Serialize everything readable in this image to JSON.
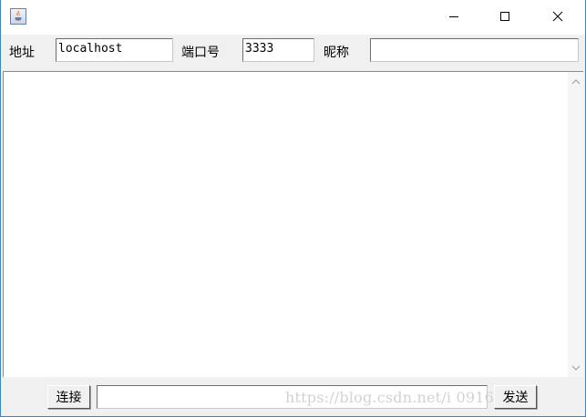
{
  "window": {
    "icon": "java-app-icon",
    "controls": {
      "minimize": "minimize-icon",
      "maximize": "maximize-icon",
      "close": "close-icon"
    }
  },
  "connection": {
    "address_label": "地址",
    "address_value": "localhost",
    "port_label": "端口号",
    "port_value": "3333",
    "nickname_label": "昵称",
    "nickname_value": ""
  },
  "chat": {
    "messages": ""
  },
  "footer": {
    "connect_label": "连接",
    "message_input_value": "",
    "send_label": "发送"
  },
  "watermark": "https://blog.csdn.net/i   0916",
  "colors": {
    "window_border": "#3c86c8",
    "background": "#f0f0f0"
  }
}
